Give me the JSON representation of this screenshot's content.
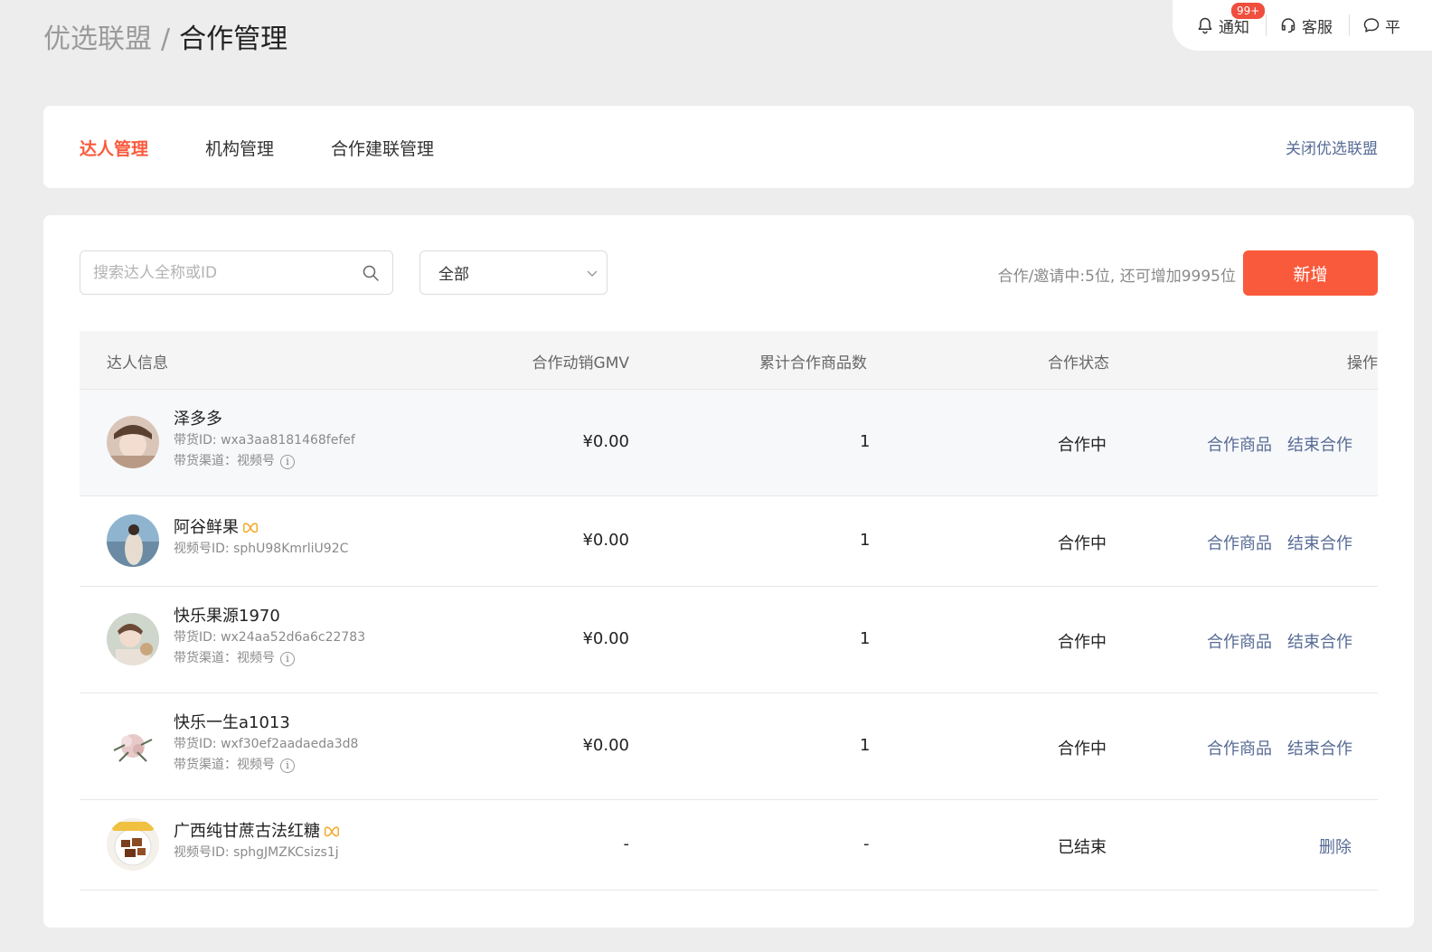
{
  "breadcrumb": {
    "parent": "优选联盟",
    "separator": "/",
    "current": "合作管理"
  },
  "topbar": {
    "notify_label": "通知",
    "notify_badge": "99+",
    "service_label": "客服",
    "feedback_label": "平"
  },
  "tabs": [
    {
      "label": "达人管理",
      "active": true
    },
    {
      "label": "机构管理",
      "active": false
    },
    {
      "label": "合作建联管理",
      "active": false
    }
  ],
  "close_link": "关闭优选联盟",
  "search": {
    "placeholder": "搜索达人全称或ID"
  },
  "filter": {
    "selected": "全部"
  },
  "quota_text": "合作/邀请中:5位, 还可增加9995位",
  "add_button": "新增",
  "table": {
    "headers": [
      "达人信息",
      "合作动销GMV",
      "累计合作商品数",
      "合作状态",
      "操作"
    ],
    "rows": [
      {
        "name": "泽多多",
        "id_line": "带货ID: wxa3aa8181468fefef",
        "channel_line": "带货渠道：视频号",
        "gmv": "¥0.00",
        "count": "1",
        "status": "合作中",
        "actions": [
          "合作商品",
          "结束合作"
        ]
      },
      {
        "name": "阿谷鲜果",
        "id_line": "视频号ID: sphU98KmrliU92C",
        "gmv": "¥0.00",
        "count": "1",
        "status": "合作中",
        "actions": [
          "合作商品",
          "结束合作"
        ]
      },
      {
        "name": "快乐果源1970",
        "id_line": "带货ID: wx24aa52d6a6c22783",
        "channel_line": "带货渠道：视频号",
        "gmv": "¥0.00",
        "count": "1",
        "status": "合作中",
        "actions": [
          "合作商品",
          "结束合作"
        ]
      },
      {
        "name": "快乐一生a1013",
        "id_line": "带货ID: wxf30ef2aadaeda3d8",
        "channel_line": "带货渠道：视频号",
        "gmv": "¥0.00",
        "count": "1",
        "status": "合作中",
        "actions": [
          "合作商品",
          "结束合作"
        ]
      },
      {
        "name": "广西纯甘蔗古法红糖",
        "id_line": "视频号ID: sphgJMZKCsizs1j",
        "gmv": "-",
        "count": "-",
        "status": "已结束",
        "actions": [
          "删除"
        ]
      }
    ]
  },
  "colors": {
    "accent": "#fa5a3c",
    "link": "#576b95",
    "badge": "#f04e3e"
  }
}
